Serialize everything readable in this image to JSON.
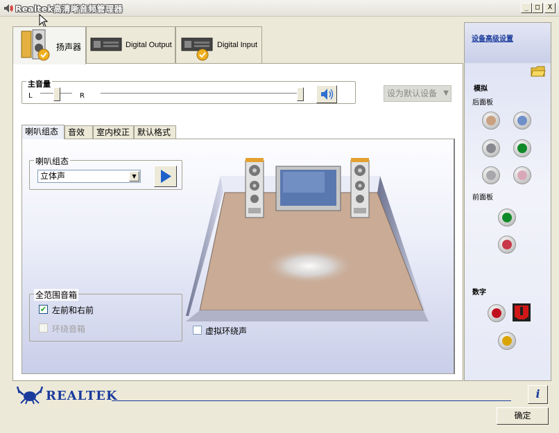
{
  "window": {
    "title": "Realtek高清晰音频管理器",
    "min_label": "_",
    "max_label": "□",
    "close_label": "X"
  },
  "device_tabs": [
    {
      "label": "扬声器",
      "active": true,
      "icon": "speaker-device-icon"
    },
    {
      "label": "Digital Output",
      "active": false,
      "icon": "digital-output-device-icon"
    },
    {
      "label": "Digital Input",
      "active": false,
      "icon": "digital-input-device-icon"
    }
  ],
  "master_volume": {
    "title": "主音量",
    "left_label": "L",
    "right_label": "R",
    "balance": 0.5,
    "volume": 1.0,
    "mute_icon": "speaker-volume-icon"
  },
  "default_device": {
    "label": "设为默认设备",
    "arrow": "▼"
  },
  "sub_tabs": [
    {
      "label": "喇叭组态",
      "active": true
    },
    {
      "label": "音效",
      "active": false
    },
    {
      "label": "室内校正",
      "active": false
    },
    {
      "label": "默认格式",
      "active": false
    }
  ],
  "speaker_config": {
    "group_title": "喇叭组态",
    "selected": "立体声",
    "dropdown_arrow": "▼",
    "play_icon": "play-icon"
  },
  "full_range": {
    "group_title": "全范围音箱",
    "front_label": "左前和右前",
    "front_checked": true,
    "front_check_mark": "✔",
    "surround_label": "环绕音箱",
    "surround_checked": false,
    "surround_enabled": false
  },
  "virtual_surround": {
    "label": "虚拟环绕声",
    "checked": false
  },
  "right_panel": {
    "advanced_link": "设备高级设置",
    "analog_label": "模拟",
    "rear_label": "后面板",
    "front_label": "前面板",
    "digital_label": "数字"
  },
  "bottom": {
    "brand": "REALTEK",
    "info_label": "i",
    "ok_label": "确定"
  },
  "colors": {
    "accent": "#1a3a9c",
    "floor": "#c9ab96",
    "jack_orange": "#c9a080",
    "jack_blue": "#6f8fc9",
    "jack_gray": "#888890",
    "jack_green": "#108a28",
    "jack_pink": "#d8a8b8",
    "jack_red": "#c83848",
    "jack_yellow": "#d9a400"
  }
}
